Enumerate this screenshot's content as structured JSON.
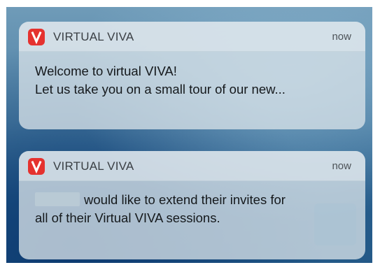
{
  "notifications": [
    {
      "app_name": "VIRTUAL VIVA",
      "icon": "app-logo-v",
      "time": "now",
      "line1": "Welcome to virtual VIVA!",
      "line2": "Let us take you on a small tour of our new..."
    },
    {
      "app_name": "VIRTUAL VIVA",
      "icon": "app-logo-v",
      "time": "now",
      "line1": "would like to extend their invites for",
      "line2": "all of their Virtual VIVA sessions."
    }
  ],
  "colors": {
    "app_icon": "#e5322f",
    "card": "#d7e2e8",
    "wallpaper_dark": "#1c4f80"
  }
}
